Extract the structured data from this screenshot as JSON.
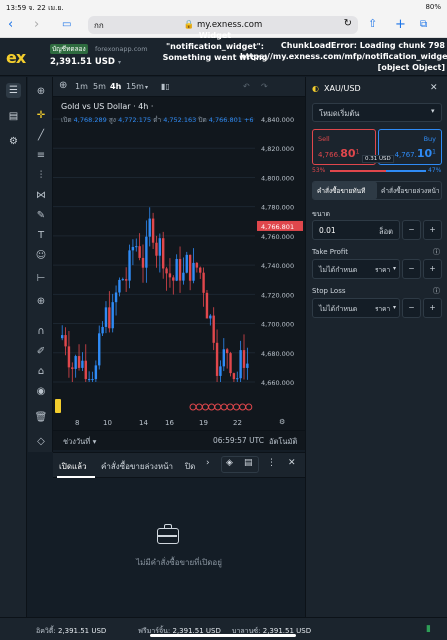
{
  "status_bar": {
    "time": "13:59",
    "date": "จ. 22 เม.ย.",
    "battery": "80%"
  },
  "browser": {
    "aa_label": "กก",
    "url": "my.exness.com"
  },
  "header": {
    "logo": "ex",
    "account_type": "บัญชีทดลอง",
    "server": "forexonapp.com",
    "balance": "2,391.51 USD",
    "error_notification": "Widget \"notification_widget\": Something went wrong",
    "error_chunk": "ChunkLoadError: Loading chunk 798 https://my.exness.com/mfp/notification_widget [object Object]"
  },
  "timeframes": [
    "1m",
    "5m",
    "4h",
    "15m"
  ],
  "active_timeframe": "4h",
  "chart": {
    "title": "Gold vs US Dollar · 4h ·",
    "ohlc": {
      "open_label": "เปิด",
      "open": "4,768.289",
      "high_label": "สูง",
      "high": "4,772.175",
      "low_label": "ต่ำ",
      "low": "4,752.163",
      "close_label": "ปิด",
      "close": "4,766.801",
      "change": "+6"
    },
    "price_ticks": [
      "4,840.000",
      "4,820.000",
      "4,800.000",
      "4,780.000",
      "4,766.801",
      "4,760.000",
      "4,740.000",
      "4,720.000",
      "4,700.000",
      "4,680.000",
      "4,660.000"
    ],
    "current_price": "4,766.801",
    "x_ticks": [
      "8",
      "10",
      "14",
      "16",
      "19",
      "22"
    ],
    "range_label": "ช่วงวันที่",
    "clock": "06:59:57 UTC",
    "auto_label": "อัตโนมัติ"
  },
  "bottom_tabs": {
    "open": "เปิดแล้ว",
    "pending": "คำสั่งซื้อขายล่วงหน้า",
    "closed": "ปิด"
  },
  "empty_state": "ไม่มีคำสั่งซื้อขายที่เปิดอยู่",
  "order_panel": {
    "symbol": "XAU/USD",
    "mode": "โหมดเริ่มต้น",
    "sell_label": "Sell",
    "sell_price_main": "4,766.",
    "sell_price_big": "80",
    "sell_price_sup": "1",
    "buy_label": "Buy",
    "buy_price_main": "4,767.",
    "buy_price_big": "10",
    "buy_price_sup": "1",
    "spread": "0.31 USD",
    "sell_pct": "53%",
    "buy_pct": "47%",
    "market_tab": "คำสั่งซื้อขายทันที",
    "pending_tab": "คำสั่งซื้อขายล่วงหน้า",
    "volume_label": "ขนาด",
    "volume_value": "0.01",
    "volume_unit": "ล็อต",
    "tp_label": "Take Profit",
    "tp_value": "ไม่ได้กำหนด",
    "tp_unit": "ราคา",
    "sl_label": "Stop Loss",
    "sl_value": "ไม่ได้กำหนด",
    "sl_unit": "ราคา"
  },
  "footer": {
    "equity_label": "อิควิตี้:",
    "equity": "2,391.51 USD",
    "free_margin_label": "ฟรีมาร์จิ้น:",
    "free_margin": "2,391.51 USD",
    "balance_label": "บาลานซ์:",
    "balance": "2,391.51 USD"
  },
  "colors": {
    "buy": "#2f8bf5",
    "sell": "#e0474c",
    "accent": "#f3cd2d"
  }
}
